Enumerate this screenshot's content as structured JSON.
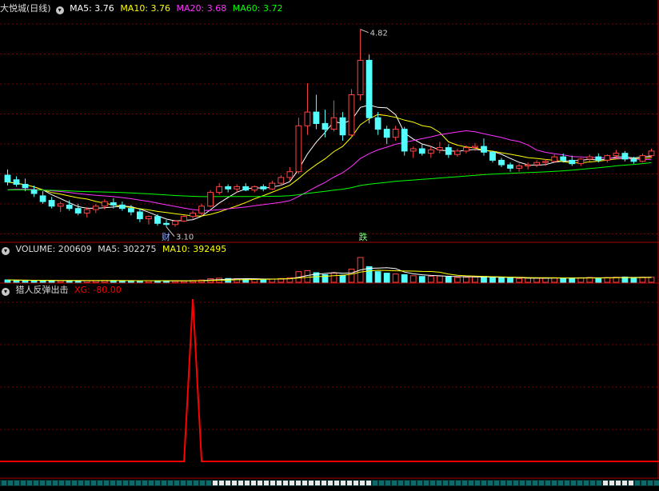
{
  "colors": {
    "up": "#ff4444",
    "down": "#54ffff",
    "ma5": "#ffffff",
    "ma10": "#ffff00",
    "ma20": "#ff33ff",
    "ma60": "#00ff00",
    "grid": "#7a0000",
    "xg": "#ff0000"
  },
  "header": {
    "title": "大悦城(日线)",
    "ma5_label": "MA5: 3.76",
    "ma10_label": "MA10: 3.76",
    "ma20_label": "MA20: 3.68",
    "ma60_label": "MA60: 3.72"
  },
  "volume_header": {
    "label": "VOLUME: 200609",
    "ma5_label": "MA5: 302275",
    "ma10_label": "MA10: 392495"
  },
  "indicator_header": {
    "name": "猎人反弹出击",
    "xg_label": "XG: -80.00"
  },
  "annotations": {
    "high_label": "4.82",
    "low_label": "3.10",
    "marker_cai": "财",
    "marker_die": "跌"
  },
  "chart_data": [
    {
      "type": "candlestick",
      "title": "大悦城(日线)",
      "ylim": [
        3.0,
        4.95
      ],
      "ohlc": [
        [
          3.55,
          3.6,
          3.46,
          3.49
        ],
        [
          3.51,
          3.54,
          3.45,
          3.47
        ],
        [
          3.47,
          3.52,
          3.41,
          3.44
        ],
        [
          3.42,
          3.46,
          3.36,
          3.39
        ],
        [
          3.37,
          3.41,
          3.3,
          3.32
        ],
        [
          3.33,
          3.36,
          3.26,
          3.28
        ],
        [
          3.28,
          3.32,
          3.23,
          3.3
        ],
        [
          3.29,
          3.33,
          3.24,
          3.26
        ],
        [
          3.26,
          3.3,
          3.2,
          3.22
        ],
        [
          3.22,
          3.27,
          3.18,
          3.25
        ],
        [
          3.25,
          3.3,
          3.22,
          3.28
        ],
        [
          3.28,
          3.34,
          3.25,
          3.32
        ],
        [
          3.31,
          3.35,
          3.26,
          3.29
        ],
        [
          3.29,
          3.32,
          3.24,
          3.26
        ],
        [
          3.26,
          3.29,
          3.2,
          3.23
        ],
        [
          3.23,
          3.26,
          3.14,
          3.17
        ],
        [
          3.17,
          3.2,
          3.12,
          3.19
        ],
        [
          3.19,
          3.21,
          3.11,
          3.13
        ],
        [
          3.13,
          3.16,
          3.1,
          3.12
        ],
        [
          3.12,
          3.16,
          3.1,
          3.15
        ],
        [
          3.15,
          3.2,
          3.14,
          3.19
        ],
        [
          3.19,
          3.24,
          3.17,
          3.22
        ],
        [
          3.22,
          3.3,
          3.2,
          3.28
        ],
        [
          3.28,
          3.42,
          3.27,
          3.4
        ],
        [
          3.4,
          3.48,
          3.38,
          3.45
        ],
        [
          3.45,
          3.47,
          3.4,
          3.43
        ],
        [
          3.43,
          3.47,
          3.4,
          3.45
        ],
        [
          3.45,
          3.48,
          3.41,
          3.42
        ],
        [
          3.42,
          3.46,
          3.4,
          3.45
        ],
        [
          3.45,
          3.47,
          3.41,
          3.43
        ],
        [
          3.43,
          3.5,
          3.42,
          3.48
        ],
        [
          3.48,
          3.55,
          3.46,
          3.53
        ],
        [
          3.53,
          3.62,
          3.5,
          3.58
        ],
        [
          3.58,
          4.05,
          3.56,
          3.98
        ],
        [
          3.98,
          4.35,
          3.9,
          4.1
        ],
        [
          4.1,
          4.25,
          3.95,
          4.0
        ],
        [
          4.0,
          4.12,
          3.88,
          3.95
        ],
        [
          3.95,
          4.2,
          3.93,
          4.05
        ],
        [
          4.05,
          4.1,
          3.85,
          3.9
        ],
        [
          3.9,
          4.3,
          3.88,
          4.25
        ],
        [
          4.25,
          4.82,
          4.2,
          4.55
        ],
        [
          4.55,
          4.6,
          4.0,
          4.05
        ],
        [
          4.05,
          4.1,
          3.9,
          3.95
        ],
        [
          3.95,
          3.98,
          3.82,
          3.88
        ],
        [
          3.88,
          3.98,
          3.85,
          3.95
        ],
        [
          3.95,
          3.97,
          3.72,
          3.76
        ],
        [
          3.76,
          3.8,
          3.7,
          3.78
        ],
        [
          3.78,
          3.82,
          3.72,
          3.74
        ],
        [
          3.74,
          3.8,
          3.7,
          3.77
        ],
        [
          3.77,
          3.84,
          3.74,
          3.79
        ],
        [
          3.79,
          3.82,
          3.7,
          3.73
        ],
        [
          3.73,
          3.78,
          3.71,
          3.76
        ],
        [
          3.76,
          3.81,
          3.74,
          3.79
        ],
        [
          3.79,
          3.83,
          3.76,
          3.8
        ],
        [
          3.8,
          3.87,
          3.72,
          3.75
        ],
        [
          3.75,
          3.76,
          3.66,
          3.68
        ],
        [
          3.68,
          3.7,
          3.62,
          3.64
        ],
        [
          3.64,
          3.66,
          3.58,
          3.61
        ],
        [
          3.61,
          3.65,
          3.58,
          3.63
        ],
        [
          3.63,
          3.66,
          3.6,
          3.64
        ],
        [
          3.64,
          3.68,
          3.62,
          3.66
        ],
        [
          3.66,
          3.69,
          3.63,
          3.67
        ],
        [
          3.67,
          3.73,
          3.66,
          3.71
        ],
        [
          3.71,
          3.74,
          3.66,
          3.68
        ],
        [
          3.68,
          3.72,
          3.63,
          3.65
        ],
        [
          3.65,
          3.7,
          3.63,
          3.69
        ],
        [
          3.69,
          3.73,
          3.67,
          3.71
        ],
        [
          3.71,
          3.74,
          3.66,
          3.68
        ],
        [
          3.68,
          3.73,
          3.66,
          3.72
        ],
        [
          3.72,
          3.77,
          3.7,
          3.74
        ],
        [
          3.74,
          3.76,
          3.67,
          3.69
        ],
        [
          3.69,
          3.71,
          3.65,
          3.67
        ],
        [
          3.67,
          3.74,
          3.66,
          3.72
        ],
        [
          3.72,
          3.78,
          3.7,
          3.76
        ]
      ],
      "ma_series": [
        {
          "name": "MA5",
          "period": 5
        },
        {
          "name": "MA10",
          "period": 10
        },
        {
          "name": "MA20",
          "period": 20
        },
        {
          "name": "MA60",
          "period": 60
        }
      ],
      "volume": [
        95,
        80,
        72,
        70,
        68,
        64,
        60,
        66,
        58,
        62,
        70,
        74,
        68,
        60,
        58,
        64,
        60,
        56,
        54,
        58,
        62,
        70,
        90,
        140,
        160,
        150,
        140,
        120,
        125,
        118,
        130,
        150,
        180,
        420,
        460,
        380,
        300,
        360,
        280,
        520,
        980,
        620,
        420,
        360,
        330,
        300,
        260,
        230,
        240,
        250,
        210,
        190,
        200,
        210,
        230,
        190,
        170,
        160,
        150,
        160,
        170,
        165,
        180,
        175,
        170,
        180,
        190,
        175,
        185,
        200,
        210,
        190,
        200,
        200.609
      ],
      "ma_vol_label": "VOLUME"
    },
    {
      "type": "line",
      "title": "猎人反弹出击",
      "series": [
        {
          "name": "XG",
          "values": [
            0,
            0,
            0,
            0,
            0,
            0,
            0,
            0,
            0,
            0,
            0,
            0,
            0,
            0,
            0,
            0,
            0,
            0,
            0,
            0,
            0,
            100,
            0,
            0,
            0,
            0,
            0,
            0,
            0,
            0,
            0,
            0,
            0,
            0,
            0,
            0,
            0,
            0,
            0,
            0,
            0,
            0,
            0,
            0,
            0,
            0,
            0,
            0,
            0,
            0,
            0,
            0,
            0,
            0,
            0,
            0,
            0,
            0,
            0,
            0,
            0,
            0,
            0,
            0,
            0,
            0,
            0,
            0,
            0,
            0,
            0,
            0,
            0,
            0
          ]
        }
      ]
    }
  ]
}
